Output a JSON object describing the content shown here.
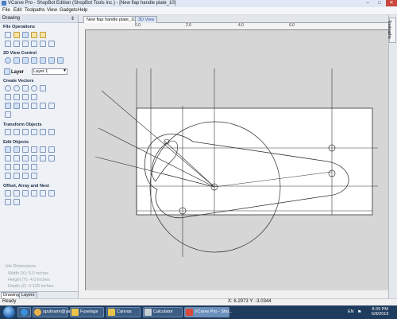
{
  "window": {
    "title": "VCarve Pro - ShopBot Edition (ShopBot Tools Inc.) - [New flap handle plate_10]",
    "minimize": "–",
    "maximize": "□",
    "close": "✕"
  },
  "menu": [
    "File",
    "Edit",
    "Toolpaths",
    "View",
    "Gadgets",
    "Help"
  ],
  "left_panel": {
    "title": "Drawing",
    "pin": "⇕",
    "sections": {
      "file_ops": "File Operations",
      "view_control": "2D View Control",
      "create_vectors": "Create Vectors",
      "transform": "Transform Objects",
      "edit_objects": "Edit Objects",
      "offset": "Offset, Array and Nest"
    },
    "layer_label": "Layer",
    "layer_value": "Layer 1",
    "job_dimensions": {
      "title": "Job Dimensions",
      "width": "Width  (X): 5.0 inches",
      "height": "Height (Y): 4.0 inches",
      "depth": "Depth  (Z): 0.125 inches"
    },
    "tabs": [
      "Drawing",
      "Layers"
    ]
  },
  "doc_tabs": [
    "New flap handle plate_10",
    "3D View"
  ],
  "right_tab": "Toolpaths",
  "ruler_labels": [
    "0.0",
    "2.0",
    "4.0",
    "6.0"
  ],
  "status": {
    "ready": "Ready",
    "coords": "X: 6.2973 Y: -3.0344"
  },
  "taskbar": {
    "items": [
      "",
      "sputnamr@yahoo...",
      "Fuselage",
      "Canvas",
      "Calculator",
      "VCarve Pro - Sho..."
    ],
    "lang": "EN",
    "time": "8:39 PM",
    "date": "6/8/2019"
  },
  "colors": {
    "canvas_bg": "#d6d6d6",
    "plate": "#ffffff",
    "title_bar": "#dfe8f4",
    "taskbar": "#1f3c5e",
    "accent": "#2d56a8"
  }
}
